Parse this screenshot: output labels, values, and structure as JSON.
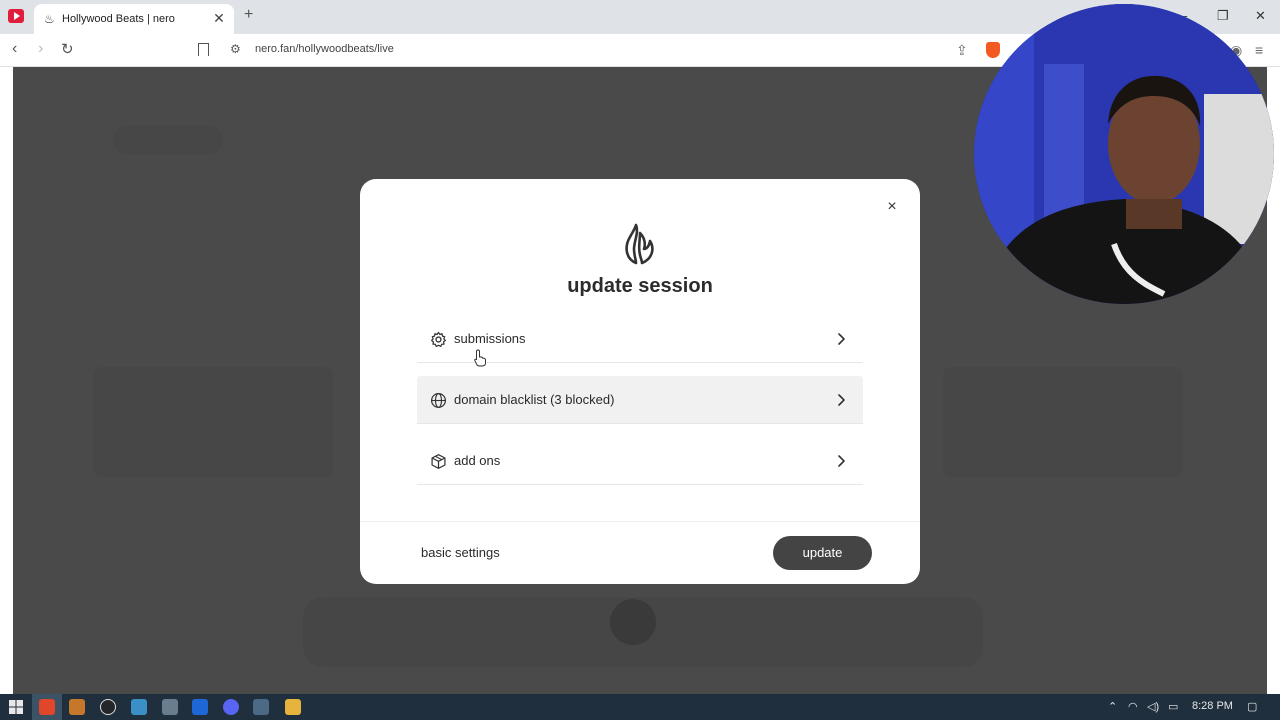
{
  "browser": {
    "tab_title": "Hollywood Beats | nero",
    "tab_favicon": "♨",
    "url": "nero.fan/hollywoodbeats/live",
    "new_tab_label": "+",
    "close_tab_label": "✕"
  },
  "modal": {
    "title": "update session",
    "close_label": "×",
    "options": [
      {
        "label": "submissions",
        "icon": "gear-icon"
      },
      {
        "label": "domain blacklist (3 blocked)",
        "icon": "globe-icon"
      },
      {
        "label": "add ons",
        "icon": "box-icon"
      }
    ],
    "basic_settings_label": "basic settings",
    "update_label": "update"
  },
  "taskbar": {
    "time": "8:28 PM"
  },
  "colors": {
    "overlay": "#4a4a4a",
    "update_button": "#444444",
    "tab_bar": "#dfe3e8",
    "taskbar": "#1f2f3d",
    "webcam_backdrop": "#1e2a9a"
  }
}
